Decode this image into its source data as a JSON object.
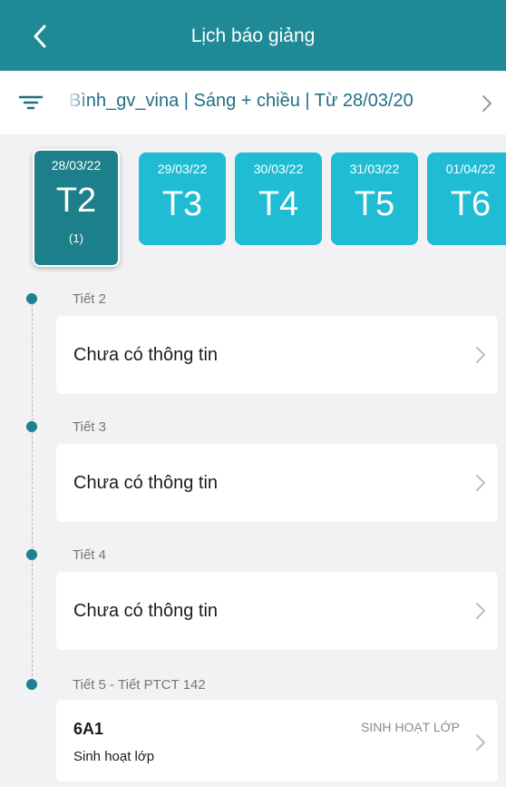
{
  "header": {
    "title": "Lịch báo giảng"
  },
  "filter": {
    "text": "ị Bình_gv_vina | Sáng + chiều | Từ 28/03/20"
  },
  "days": [
    {
      "date": "28/03/22",
      "label": "T2",
      "count": "(1)",
      "active": true
    },
    {
      "date": "29/03/22",
      "label": "T3"
    },
    {
      "date": "30/03/22",
      "label": "T4"
    },
    {
      "date": "31/03/22",
      "label": "T5"
    },
    {
      "date": "01/04/22",
      "label": "T6"
    }
  ],
  "periods": [
    {
      "label": "Tiết 2",
      "content": "Chưa có thông tin"
    },
    {
      "label": "Tiết 3",
      "content": "Chưa có thông tin"
    },
    {
      "label": "Tiết 4",
      "content": "Chưa có thông tin"
    },
    {
      "label": "Tiết 5 - Tiết PTCT 142",
      "class_name": "6A1",
      "lesson_type": "SINH HOẠT LỚP",
      "lesson_name": "Sinh hoạt lớp"
    }
  ],
  "colors": {
    "header": "#1f8a96",
    "day_active": "#1d7f8a",
    "day_inactive": "#1fbcd4",
    "filter_text": "#1f6f86",
    "timeline_dot": "#1f7f94"
  },
  "icons": {
    "back": "chevron-left-icon",
    "filter": "filter-icon",
    "forward": "chevron-right-icon"
  }
}
